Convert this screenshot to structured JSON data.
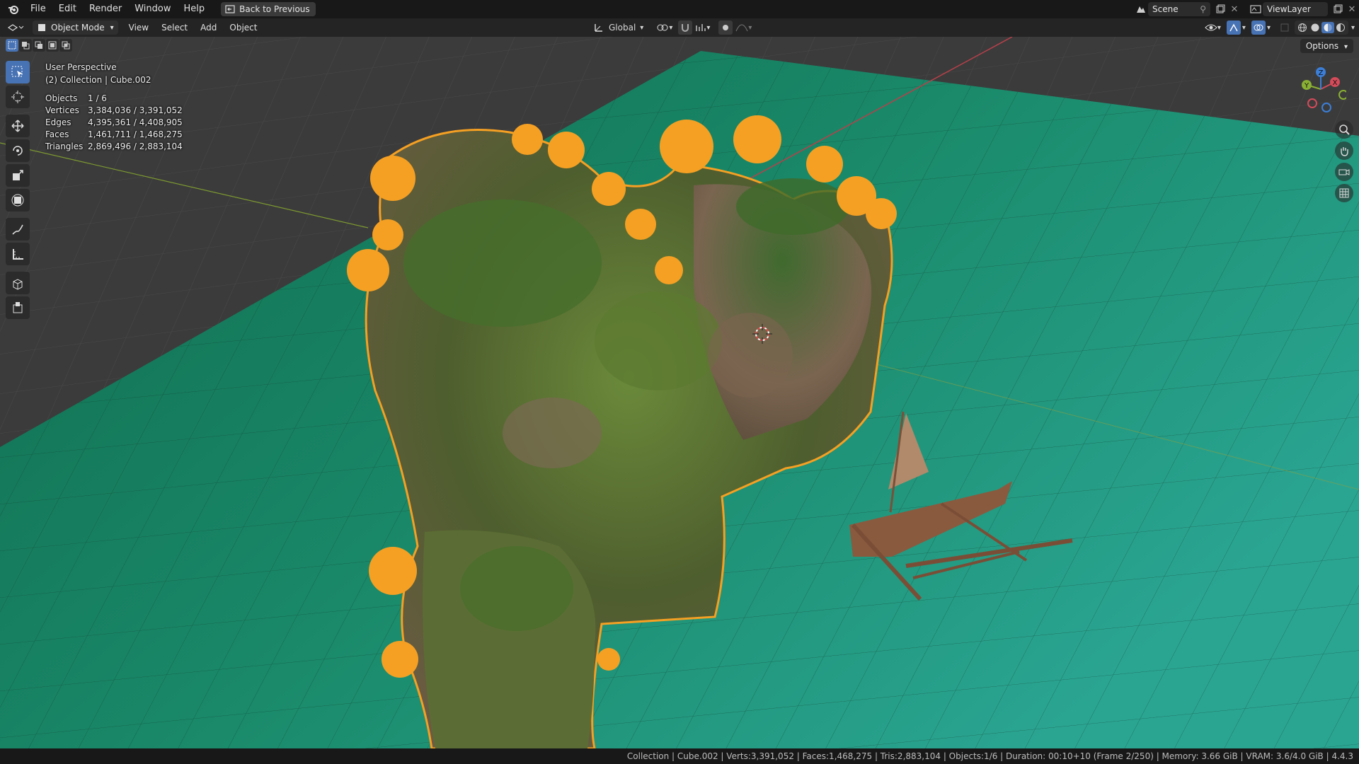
{
  "topbar": {
    "menus": [
      "File",
      "Edit",
      "Render",
      "Window",
      "Help"
    ],
    "back_button": "Back to Previous",
    "scene_name": "Scene",
    "view_layer": "ViewLayer"
  },
  "header": {
    "mode": "Object Mode",
    "menus": [
      "View",
      "Select",
      "Add",
      "Object"
    ],
    "transform_orientation": "Global",
    "options_label": "Options"
  },
  "viewport": {
    "perspective": "User Perspective",
    "collection_info": "(2) Collection | Cube.002",
    "stats": [
      {
        "label": "Objects",
        "value": "1 / 6"
      },
      {
        "label": "Vertices",
        "value": "3,384,036 / 3,391,052"
      },
      {
        "label": "Edges",
        "value": "4,395,361 / 4,408,905"
      },
      {
        "label": "Faces",
        "value": "1,461,711 / 1,468,275"
      },
      {
        "label": "Triangles",
        "value": "2,869,496 / 2,883,104"
      }
    ],
    "gizmo_axes": [
      "X",
      "Y",
      "Z"
    ]
  },
  "colors": {
    "accent": "#4772b3",
    "selection_outline": "#f5a023",
    "water": "#1a7a5c",
    "axis_x": "#d44b5a",
    "axis_y": "#8ab034",
    "axis_z": "#3c7fd8"
  },
  "statusbar": {
    "text": "Collection | Cube.002 | Verts:3,391,052 | Faces:1,468,275 | Tris:2,883,104 | Objects:1/6 | Duration: 00:10+10 (Frame 2/250) | Memory: 3.66 GiB | VRAM: 3.6/4.0 GiB | 4.4.3"
  }
}
